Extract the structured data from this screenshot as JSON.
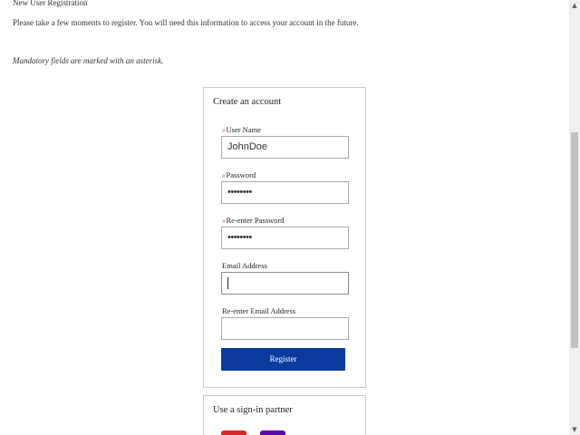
{
  "page": {
    "title": "New User Registration",
    "intro": "Please take a few moments to register. You will need this information to access your account in the future.",
    "mandatory_note": "Mandatory fields are marked with an asterisk."
  },
  "create_account": {
    "heading": "Create an account",
    "required_marker": "»",
    "fields": {
      "username": {
        "label": "User Name",
        "value": "JohnDoe",
        "required": true
      },
      "password": {
        "label": "Password",
        "value": "••••••••",
        "required": true
      },
      "password_confirm": {
        "label": "Re-enter Password",
        "value": "••••••••",
        "required": true
      },
      "email": {
        "label": "Email Address",
        "value": "",
        "required": false
      },
      "email_confirm": {
        "label": "Re-enter Email Address",
        "value": "",
        "required": false
      }
    },
    "register_label": "Register"
  },
  "sign_in_partner": {
    "heading": "Use a sign-in partner"
  },
  "colors": {
    "button": "#0b3a9e",
    "required_marker": "#c0392b",
    "partner_1": "#d62828",
    "partner_2": "#5a0aa8"
  },
  "icons": {
    "scroll_up": "up-arrow-icon",
    "scroll_down": "down-arrow-icon"
  }
}
